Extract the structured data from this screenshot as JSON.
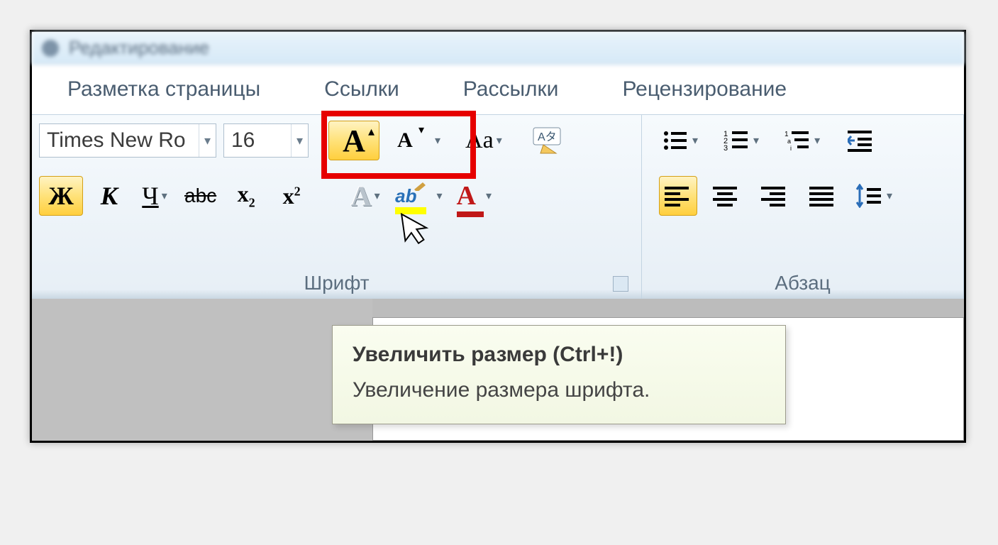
{
  "titlebar": {
    "text": "Редактирование"
  },
  "tabs": {
    "page_layout": "Разметка страницы",
    "references": "Ссылки",
    "mailings": "Рассылки",
    "review": "Рецензирование"
  },
  "font_group": {
    "label": "Шрифт",
    "font_name": "Times New Ro",
    "font_size": "16",
    "bold": "Ж",
    "italic": "К",
    "underline": "Ч",
    "strike": "abc",
    "subscript": "x",
    "subscript_sub": "2",
    "superscript": "x",
    "superscript_sup": "2",
    "grow_font": "A",
    "shrink_font": "A",
    "change_case": "Aa",
    "clear_format_label": "Aタ",
    "text_effects": "A",
    "highlight": "ab",
    "font_color": "A"
  },
  "para_group": {
    "label": "Абзац"
  },
  "tooltip": {
    "title": "Увеличить размер (Ctrl+!)",
    "body": "Увеличение размера шрифта."
  }
}
